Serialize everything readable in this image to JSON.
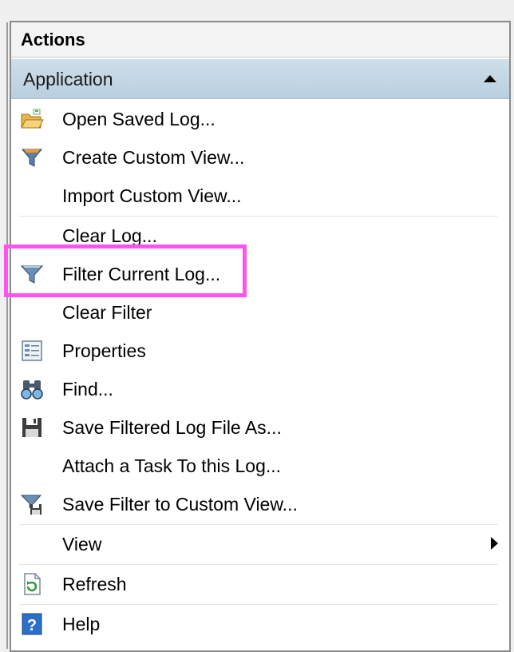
{
  "panel": {
    "title": "Actions"
  },
  "section": {
    "title": "Application"
  },
  "items": [
    {
      "label": "Open Saved Log...",
      "icon": "open-folder-icon"
    },
    {
      "label": "Create Custom View...",
      "icon": "create-filter-icon"
    },
    {
      "label": "Import Custom View...",
      "icon": ""
    },
    {
      "label": "Clear Log...",
      "icon": ""
    },
    {
      "label": "Filter Current Log...",
      "icon": "filter-funnel-icon"
    },
    {
      "label": "Clear Filter",
      "icon": ""
    },
    {
      "label": "Properties",
      "icon": "properties-icon"
    },
    {
      "label": "Find...",
      "icon": "binoculars-icon"
    },
    {
      "label": "Save Filtered Log File As...",
      "icon": "floppy-disk-icon"
    },
    {
      "label": "Attach a Task To this Log...",
      "icon": ""
    },
    {
      "label": "Save Filter to Custom View...",
      "icon": "save-filter-icon"
    },
    {
      "label": "View",
      "icon": ""
    },
    {
      "label": "Refresh",
      "icon": "refresh-icon"
    },
    {
      "label": "Help",
      "icon": "help-icon"
    }
  ],
  "colors": {
    "highlight": "#ff55ee",
    "section_header": "#c4d7e6"
  }
}
